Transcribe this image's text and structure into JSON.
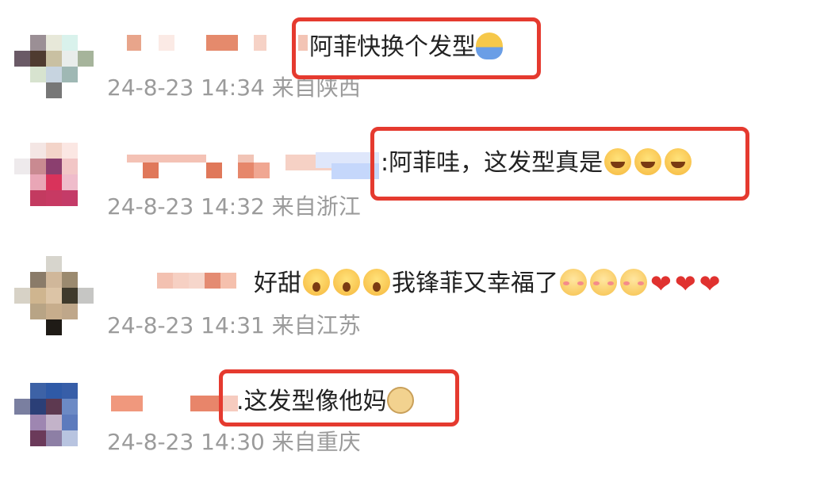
{
  "comments": [
    {
      "text": "阿菲快换个发型",
      "meta": "24-8-23 14:34 来自陕西",
      "emojis_suffix": [
        "raising-hand-emoji"
      ]
    },
    {
      "text": ":阿菲哇，这发型真是",
      "meta": "24-8-23 14:32 来自浙江",
      "emojis_suffix": [
        "laugh-cry-emoji",
        "laugh-cry-emoji",
        "laugh-cry-emoji"
      ]
    },
    {
      "text_a": "好甜",
      "text_b": "我锋菲又幸福了",
      "meta": "24-8-23 14:31 来自江苏",
      "emojis_mid": [
        "shocked-emoji",
        "shocked-emoji",
        "shocked-emoji"
      ],
      "emojis_suffix": [
        "shy-heart-emoji",
        "shy-heart-emoji",
        "shy-heart-emoji",
        "heart",
        "heart",
        "heart"
      ]
    },
    {
      "text": ".这发型像他妈",
      "meta": "24-8-23 14:30 来自重庆",
      "emojis_suffix": [
        "doge-emoji"
      ]
    }
  ],
  "colors": {
    "highlight": "#e53a2f",
    "meta_text": "#9b9b9b",
    "body_text": "#222222",
    "heart": "#e0322f"
  }
}
